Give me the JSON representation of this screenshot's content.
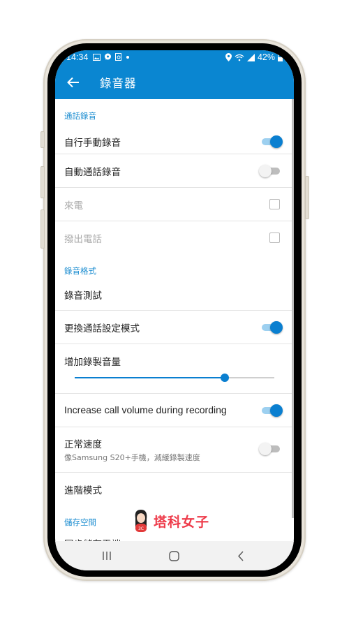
{
  "status_bar": {
    "time": "14:34",
    "left_icons": [
      "gallery-icon",
      "messenger-icon",
      "screenshot-icon",
      "dot-icon"
    ],
    "right_icons": [
      "location-icon",
      "wifi-icon",
      "signal-icon"
    ],
    "battery": "42%"
  },
  "app_bar": {
    "back_icon": "arrow-left-icon",
    "title": "錄音器"
  },
  "sections": {
    "call_recording": "通話錄音",
    "recording_format": "錄音格式",
    "storage": "儲存空間"
  },
  "settings": {
    "manual_recording": {
      "title": "自行手動錄音",
      "enabled": true
    },
    "auto_recording": {
      "title": "自動通話錄音",
      "enabled": false
    },
    "incoming": {
      "title": "來電",
      "checked": false,
      "disabled": true
    },
    "outgoing": {
      "title": "撥出電話",
      "checked": false,
      "disabled": true
    },
    "recording_test": {
      "title": "錄音測試"
    },
    "switch_call_mode": {
      "title": "更換通話設定模式",
      "enabled": true
    },
    "increase_volume": {
      "title": "增加錄製音量",
      "value_percent": 75
    },
    "increase_call_volume": {
      "title": "Increase call volume during recording",
      "enabled": true
    },
    "normal_speed": {
      "title": "正常速度",
      "subtitle": "像Samsung S20+手機，減緩錄製速度",
      "enabled": false
    },
    "advanced_mode": {
      "title": "進階模式"
    },
    "partial_next": {
      "title": "同步儲存雲端..."
    }
  },
  "watermark": {
    "text": "塔科女子"
  },
  "nav_bar": {
    "recents": "recents-icon",
    "home": "home-icon",
    "back": "back-icon"
  },
  "colors": {
    "accent": "#0a86d1",
    "switch_on": "#0a7fd0",
    "section_header": "#1a8cd0",
    "watermark": "#ee3b4a"
  }
}
